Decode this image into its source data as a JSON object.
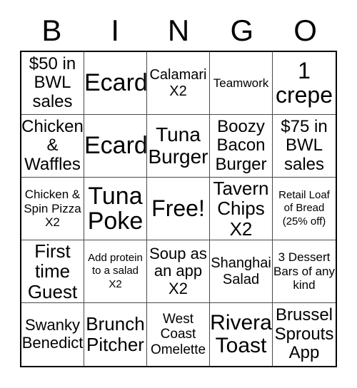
{
  "card": {
    "headers": [
      "B",
      "I",
      "N",
      "G",
      "O"
    ],
    "free_space_index": 12,
    "colors": {
      "background": "#ffffff",
      "text": "#000000",
      "outer_border": "#000000",
      "inner_border": "#4a4a4a"
    },
    "cells": [
      {
        "text": "$50 in BWL sales",
        "size": "fs-24"
      },
      {
        "text": "Ecard",
        "size": "fs-34"
      },
      {
        "text": "Calamari X2",
        "size": "fs-20"
      },
      {
        "text": "Teamwork",
        "size": "fs-17"
      },
      {
        "text": "1 crepe",
        "size": "fs-32"
      },
      {
        "text": "Chicken & Waffles",
        "size": "fs-24"
      },
      {
        "text": "Ecard",
        "size": "fs-34"
      },
      {
        "text": "Tuna Burger",
        "size": "fs-28"
      },
      {
        "text": "Boozy Bacon Burger",
        "size": "fs-24"
      },
      {
        "text": "$75 in BWL sales",
        "size": "fs-24"
      },
      {
        "text": "Chicken & Spin Pizza X2",
        "size": "fs-17"
      },
      {
        "text": "Tuna Poke",
        "size": "fs-34"
      },
      {
        "text": "Free!",
        "size": "fs-32"
      },
      {
        "text": "Tavern Chips X2",
        "size": "fs-26"
      },
      {
        "text": "Retail Loaf of Bread (25% off)",
        "size": "fs-15"
      },
      {
        "text": "First time Guest",
        "size": "fs-26"
      },
      {
        "text": "Add protein to a salad X2",
        "size": "fs-15"
      },
      {
        "text": "Soup as an app X2",
        "size": "fs-22"
      },
      {
        "text": "Shanghai Salad",
        "size": "fs-20"
      },
      {
        "text": "3 Dessert Bars of any kind",
        "size": "fs-17"
      },
      {
        "text": "Swanky Benedict",
        "size": "fs-22"
      },
      {
        "text": "Brunch Pitcher",
        "size": "fs-26"
      },
      {
        "text": "West Coast Omelette",
        "size": "fs-19"
      },
      {
        "text": "Rivera Toast",
        "size": "fs-30"
      },
      {
        "text": "Brussel Sprouts App",
        "size": "fs-24"
      }
    ]
  }
}
